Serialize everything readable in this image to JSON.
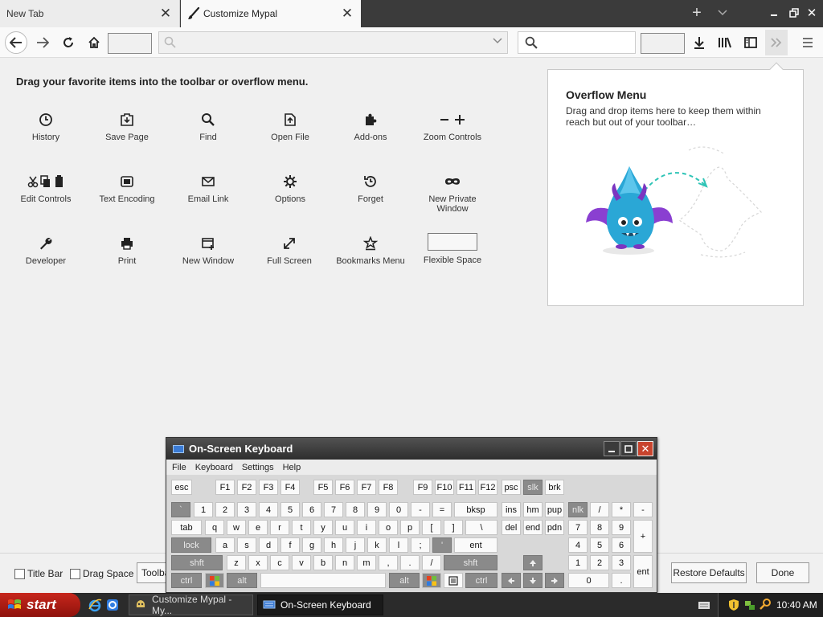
{
  "browser": {
    "tabs": [
      {
        "label": "New Tab",
        "active": false
      },
      {
        "label": "Customize Mypal",
        "active": true
      }
    ]
  },
  "customize": {
    "instructions": "Drag your favorite items into the toolbar or overflow menu.",
    "palette": [
      {
        "label": "History",
        "icon": "clock-icon"
      },
      {
        "label": "Save Page",
        "icon": "save-page-icon"
      },
      {
        "label": "Find",
        "icon": "magnifier-icon"
      },
      {
        "label": "Open File",
        "icon": "open-file-icon"
      },
      {
        "label": "Add-ons",
        "icon": "puzzle-icon"
      },
      {
        "label": "Zoom Controls",
        "icon": "zoom-controls-icon"
      },
      {
        "label": "Edit Controls",
        "icon": "edit-controls-icon"
      },
      {
        "label": "Text Encoding",
        "icon": "text-encoding-icon"
      },
      {
        "label": "Email Link",
        "icon": "envelope-icon"
      },
      {
        "label": "Options",
        "icon": "gear-icon"
      },
      {
        "label": "Forget",
        "icon": "forget-icon"
      },
      {
        "label": "New Private Window",
        "icon": "mask-icon"
      },
      {
        "label": "Developer",
        "icon": "wrench-icon"
      },
      {
        "label": "Print",
        "icon": "printer-icon"
      },
      {
        "label": "New Window",
        "icon": "new-window-icon"
      },
      {
        "label": "Full Screen",
        "icon": "fullscreen-icon"
      },
      {
        "label": "Bookmarks Menu",
        "icon": "bookmarks-menu-icon"
      },
      {
        "label": "Flexible Space",
        "icon": "flexible-space-box"
      }
    ],
    "overflow_menu": {
      "title": "Overflow Menu",
      "description": "Drag and drop items here to keep them within reach but out of your toolbar…"
    },
    "bottom": {
      "title_bar": "Title Bar",
      "drag_space": "Drag Space",
      "toolbars_partial": "Toolba",
      "restore_defaults": "Restore Defaults",
      "done": "Done"
    }
  },
  "osk": {
    "title": "On-Screen Keyboard",
    "menu": [
      "File",
      "Keyboard",
      "Settings",
      "Help"
    ],
    "keys": {
      "esc": "esc",
      "fkeys": [
        "F1",
        "F2",
        "F3",
        "F4",
        "F5",
        "F6",
        "F7",
        "F8",
        "F9",
        "F10",
        "F11",
        "F12"
      ],
      "psc": "psc",
      "slk": "slk",
      "brk": "brk",
      "backtick": "`",
      "digits": [
        "1",
        "2",
        "3",
        "4",
        "5",
        "6",
        "7",
        "8",
        "9",
        "0"
      ],
      "minus": "-",
      "equals": "=",
      "bksp": "bksp",
      "ins": "ins",
      "hm": "hm",
      "pup": "pup",
      "nlk": "nlk",
      "np_div": "/",
      "np_mul": "*",
      "np_sub": "-",
      "tab": "tab",
      "row_q": [
        "q",
        "w",
        "e",
        "r",
        "t",
        "y",
        "u",
        "i",
        "o",
        "p",
        "[",
        "]",
        "\\"
      ],
      "del": "del",
      "end": "end",
      "pdn": "pdn",
      "np_7": "7",
      "np_8": "8",
      "np_9": "9",
      "np_add": "+",
      "lock": "lock",
      "row_a": [
        "a",
        "s",
        "d",
        "f",
        "g",
        "h",
        "j",
        "k",
        "l",
        ";"
      ],
      "quote": "'",
      "ent": "ent",
      "np_4": "4",
      "np_5": "5",
      "np_6": "6",
      "shft": "shft",
      "row_z": [
        "z",
        "x",
        "c",
        "v",
        "b",
        "n",
        "m",
        ",",
        ".",
        "/"
      ],
      "np_1": "1",
      "np_2": "2",
      "np_3": "3",
      "np_ent": "ent",
      "ctrl": "ctrl",
      "alt": "alt",
      "np_0": "0",
      "np_dot": "."
    }
  },
  "taskbar": {
    "start": "start",
    "items": [
      {
        "label": "Customize Mypal - My...",
        "active": false
      },
      {
        "label": "On-Screen Keyboard",
        "active": true
      }
    ],
    "clock": "10:40 AM"
  }
}
